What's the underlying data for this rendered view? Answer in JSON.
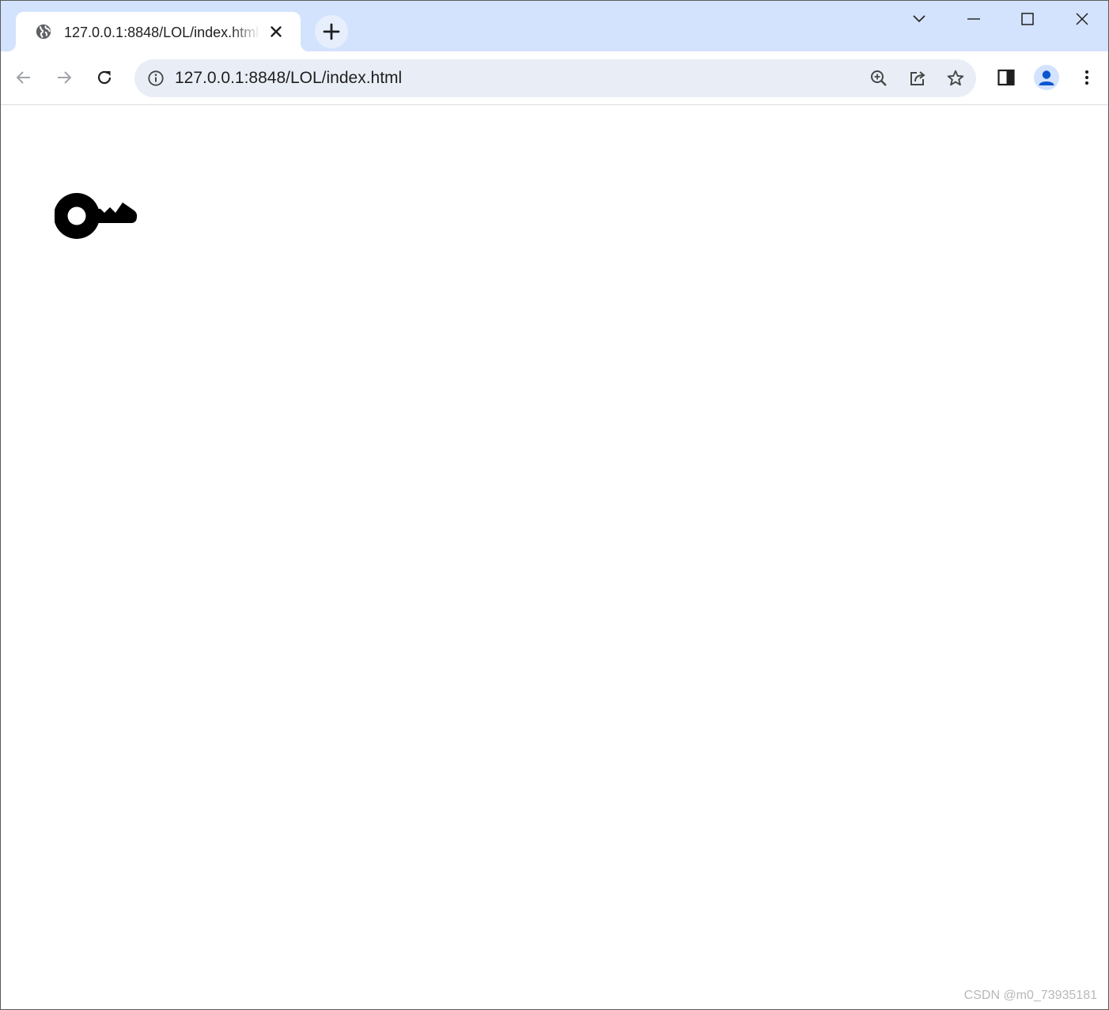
{
  "tab": {
    "title": "127.0.0.1:8848/LOL/index.html",
    "favicon": "globe-icon",
    "close_icon": "close-icon"
  },
  "new_tab_icon": "plus-icon",
  "window_controls": [
    "chevron-down-icon",
    "minimize-icon",
    "maximize-icon",
    "close-icon"
  ],
  "toolbar": {
    "back_icon": "arrow-left-icon",
    "forward_icon": "arrow-right-icon",
    "reload_icon": "reload-icon",
    "side_panel_icon": "side-panel-icon",
    "profile_icon": "profile-avatar-icon",
    "menu_icon": "kebab-menu-icon"
  },
  "omnibox": {
    "url": "127.0.0.1:8848/LOL/index.html",
    "info_icon": "info-icon",
    "zoom_icon": "zoom-in-icon",
    "share_icon": "share-icon",
    "bookmark_icon": "star-icon"
  },
  "page": {
    "content_icon": "key-icon"
  },
  "watermark": "CSDN @m0_73935181",
  "colors": {
    "tabstrip_bg": "#d3e3fd",
    "omnibox_bg": "#e9eef6",
    "icon_color": "#444746",
    "avatar_accent": "#0b57d0"
  }
}
